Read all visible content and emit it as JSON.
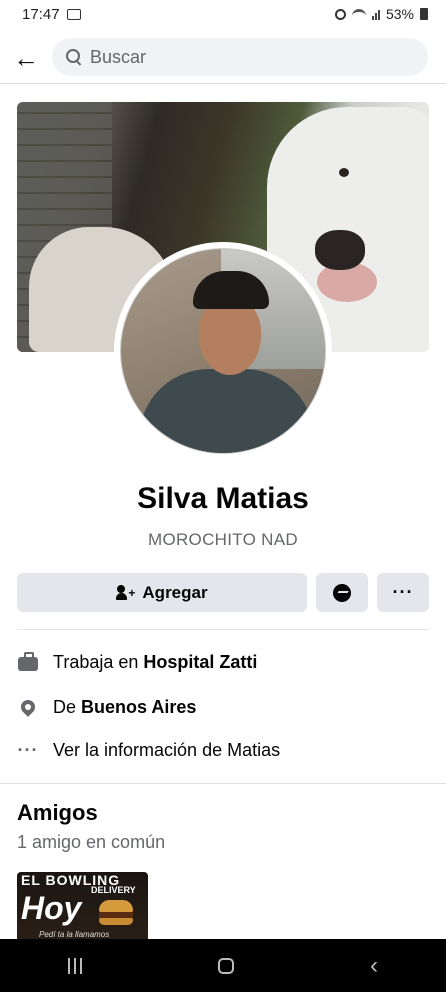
{
  "status_bar": {
    "time": "17:47",
    "battery": "53%"
  },
  "topbar": {
    "back_icon": "arrow-left-icon",
    "search_placeholder": "Buscar"
  },
  "profile": {
    "name": "Silva Matias",
    "bio": "MOROCHITO NAD",
    "actions": {
      "add_label": "Agregar",
      "message_icon": "messenger-icon",
      "more_label": "···"
    }
  },
  "details": [
    {
      "icon": "briefcase-icon",
      "prefix": "Trabaja en",
      "value": "Hospital Zatti"
    },
    {
      "icon": "location-pin-icon",
      "prefix": "De",
      "value": "Buenos Aires"
    },
    {
      "icon": "more-dots-icon",
      "prefix": "Ver la información de Matias",
      "value": ""
    }
  ],
  "friends": {
    "title": "Amigos",
    "subtitle": "1 amigo en común",
    "thumb": {
      "line1": "EL BOWLING",
      "line2": "DELIVERY",
      "line3": "Hoy",
      "line4": "Pedí ta la llamamos"
    }
  }
}
